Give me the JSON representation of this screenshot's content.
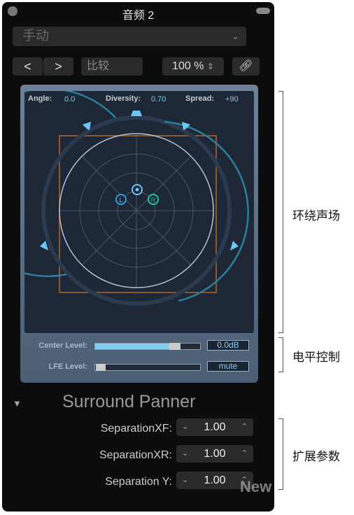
{
  "window": {
    "title": "音频 2"
  },
  "toolbar": {
    "preset": "手动",
    "prev": "<",
    "next": ">",
    "compare": "比较",
    "zoom": "100 %"
  },
  "panner": {
    "angle_label": "Angle:",
    "angle": "0.0",
    "diversity_label": "Diversity:",
    "diversity": "0.70",
    "spread_label": "Spread:",
    "spread": "+90",
    "left_label": "L",
    "right_label": "R",
    "center_level_label": "Center Level:",
    "center_level": "0.0dB",
    "center_level_fraction": 0.73,
    "lfe_level_label": "LFE Level:",
    "lfe_level": "mute",
    "lfe_level_fraction": 0.0
  },
  "section": {
    "title": "Surround Panner"
  },
  "params": [
    {
      "label": "SeparationXF:",
      "value": "1.00"
    },
    {
      "label": "SeparationXR:",
      "value": "1.00"
    },
    {
      "label": "Separation Y:",
      "value": "1.00"
    }
  ],
  "annotations": {
    "surround": "环绕声场",
    "level": "电平控制",
    "params": "扩展参数"
  },
  "watermark": "VFX News",
  "colors": {
    "accent": "#7fcff4",
    "left": "#2f9ee0",
    "right": "#1fc79a",
    "square": "#b5652a"
  }
}
